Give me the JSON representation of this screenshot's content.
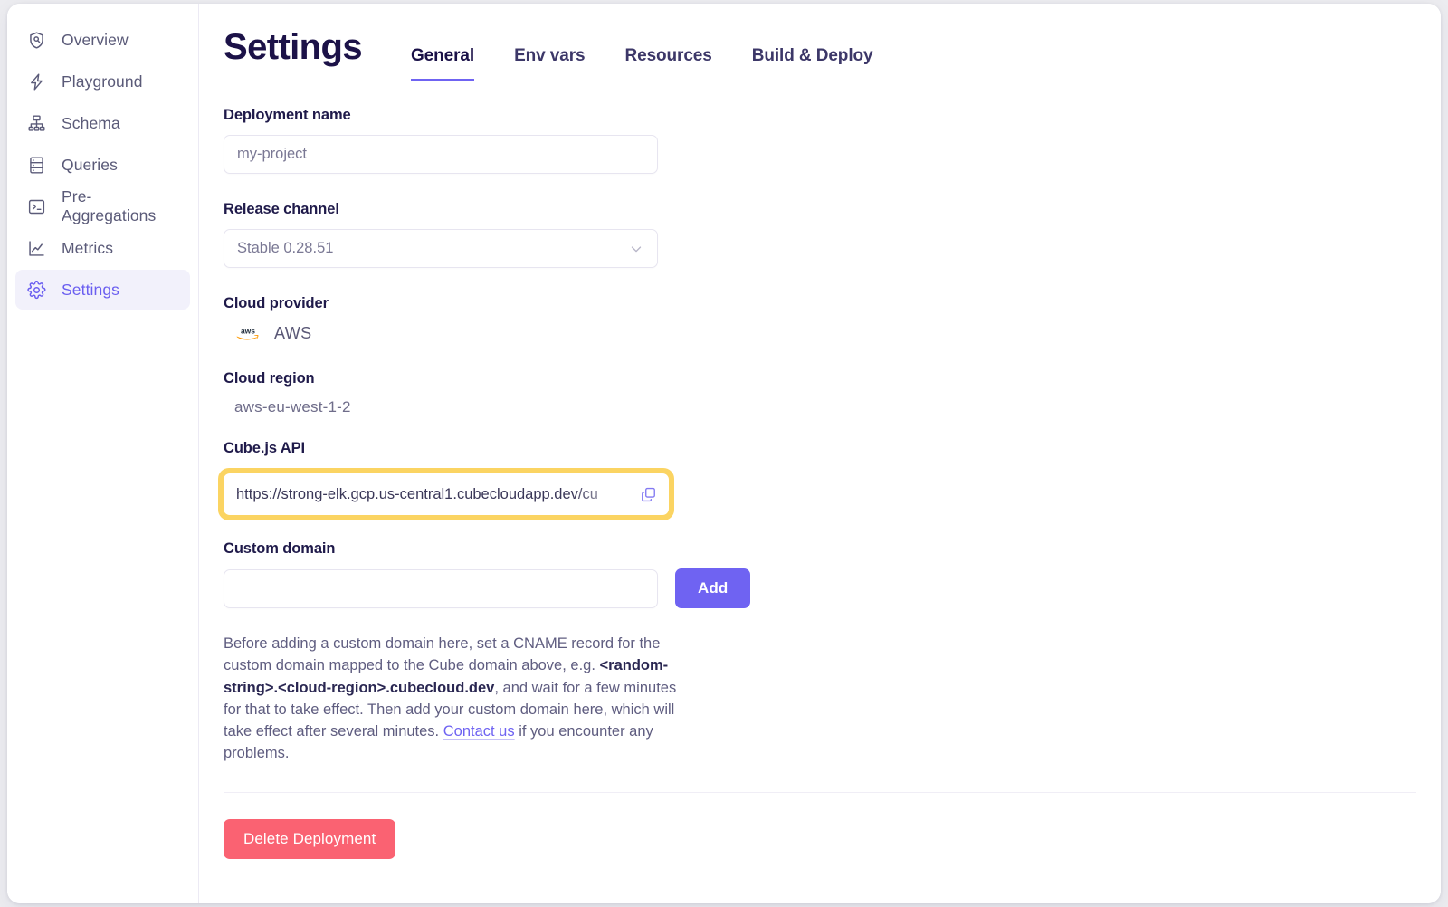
{
  "sidebar": {
    "items": [
      {
        "label": "Overview",
        "icon": "shield-search-icon",
        "active": false
      },
      {
        "label": "Playground",
        "icon": "lightning-icon",
        "active": false
      },
      {
        "label": "Schema",
        "icon": "hierarchy-icon",
        "active": false
      },
      {
        "label": "Queries",
        "icon": "server-list-icon",
        "active": false
      },
      {
        "label": "Pre-Aggregations",
        "icon": "terminal-icon",
        "active": false
      },
      {
        "label": "Metrics",
        "icon": "line-chart-icon",
        "active": false
      },
      {
        "label": "Settings",
        "icon": "gear-icon",
        "active": true
      }
    ]
  },
  "header": {
    "title": "Settings",
    "tabs": [
      {
        "label": "General",
        "active": true
      },
      {
        "label": "Env vars",
        "active": false
      },
      {
        "label": "Resources",
        "active": false
      },
      {
        "label": "Build & Deploy",
        "active": false
      }
    ]
  },
  "form": {
    "deployment_name": {
      "label": "Deployment name",
      "value": "my-project",
      "placeholder": "my-project"
    },
    "release_channel": {
      "label": "Release channel",
      "value": "Stable 0.28.51",
      "chevron": "chevron-down-icon"
    },
    "cloud_provider": {
      "label": "Cloud provider",
      "logo": "aws-logo",
      "value": "AWS"
    },
    "cloud_region": {
      "label": "Cloud region",
      "value": "aws-eu-west-1-2"
    },
    "cube_api": {
      "label": "Cube.js API",
      "value": "https://strong-elk.gcp.us-central1.cubecloudapp.dev/cu",
      "copy_icon": "copy-icon",
      "highlighted": true,
      "highlight_color": "#fbd462"
    },
    "custom_domain": {
      "label": "Custom domain",
      "value": "",
      "placeholder": "",
      "add_label": "Add"
    },
    "help": {
      "part1": "Before adding a custom domain here, set a CNAME record for the custom domain mapped to the Cube domain above, e.g. ",
      "code": "<random-string>.<cloud-region>.cubecloud.dev",
      "part2": ", and wait for a few minutes for that to take effect. Then add your custom domain here, which will take effect after several minutes. ",
      "link": "Contact us",
      "part3": " if you encounter any problems."
    },
    "delete": {
      "label": "Delete Deployment",
      "color": "#fa6272"
    }
  },
  "colors": {
    "accent": "#6f63f2",
    "title": "#1c1248",
    "danger": "#fa6272",
    "highlight": "#fbd462",
    "active_nav_bg": "#f2f1fb"
  }
}
